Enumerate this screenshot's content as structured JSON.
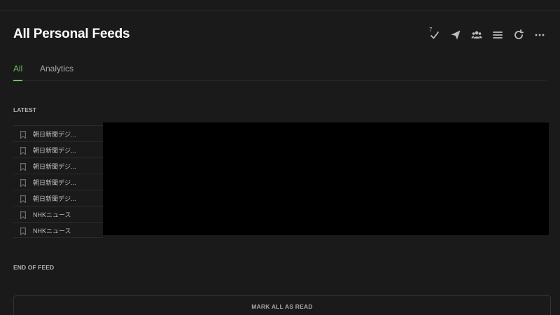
{
  "header": {
    "title": "All Personal Feeds"
  },
  "toolbar": {
    "unread_count": "7",
    "icons": [
      "check-icon",
      "send-icon",
      "group-icon",
      "menu-icon",
      "refresh-icon",
      "more-icon"
    ]
  },
  "tabs": [
    {
      "label": "All",
      "active": true
    },
    {
      "label": "Analytics",
      "active": false
    }
  ],
  "sections": {
    "latest": "LATEST",
    "end": "END OF FEED"
  },
  "feed_items": [
    {
      "source": "朝日新聞デジ..."
    },
    {
      "source": "朝日新聞デジ..."
    },
    {
      "source": "朝日新聞デジ..."
    },
    {
      "source": "朝日新聞デジ..."
    },
    {
      "source": "朝日新聞デジ..."
    },
    {
      "source": "NHKニュース"
    },
    {
      "source": "NHKニュース"
    }
  ],
  "footer": {
    "mark_all_label": "MARK ALL AS READ"
  },
  "colors": {
    "background": "#1a1a1a",
    "accent": "#6dc25b",
    "redacted": "#000000"
  }
}
